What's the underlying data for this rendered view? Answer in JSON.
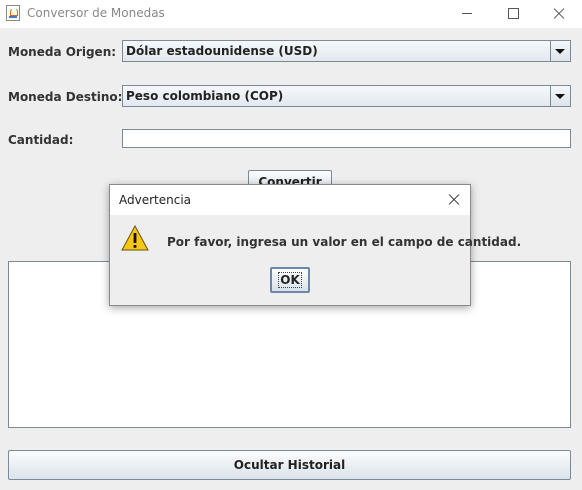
{
  "window": {
    "title": "Conversor de Monedas",
    "icon": "java-cup-icon"
  },
  "form": {
    "origin_label": "Moneda Origen:",
    "origin_value": "Dólar estadounidense (USD)",
    "destination_label": "Moneda Destino:",
    "destination_value": "Peso colombiano (COP)",
    "amount_label": "Cantidad:",
    "amount_value": "",
    "convert_button": "Convertir"
  },
  "history": {
    "content": "",
    "toggle_button": "Ocultar Historial"
  },
  "dialog": {
    "title": "Advertencia",
    "icon": "warning-icon",
    "message": "Por favor, ingresa un valor en el campo de cantidad.",
    "ok_button": "OK"
  },
  "colors": {
    "window_background": "#eeeeee",
    "border": "#7a8a99",
    "warning_fill": "#f5c518"
  }
}
